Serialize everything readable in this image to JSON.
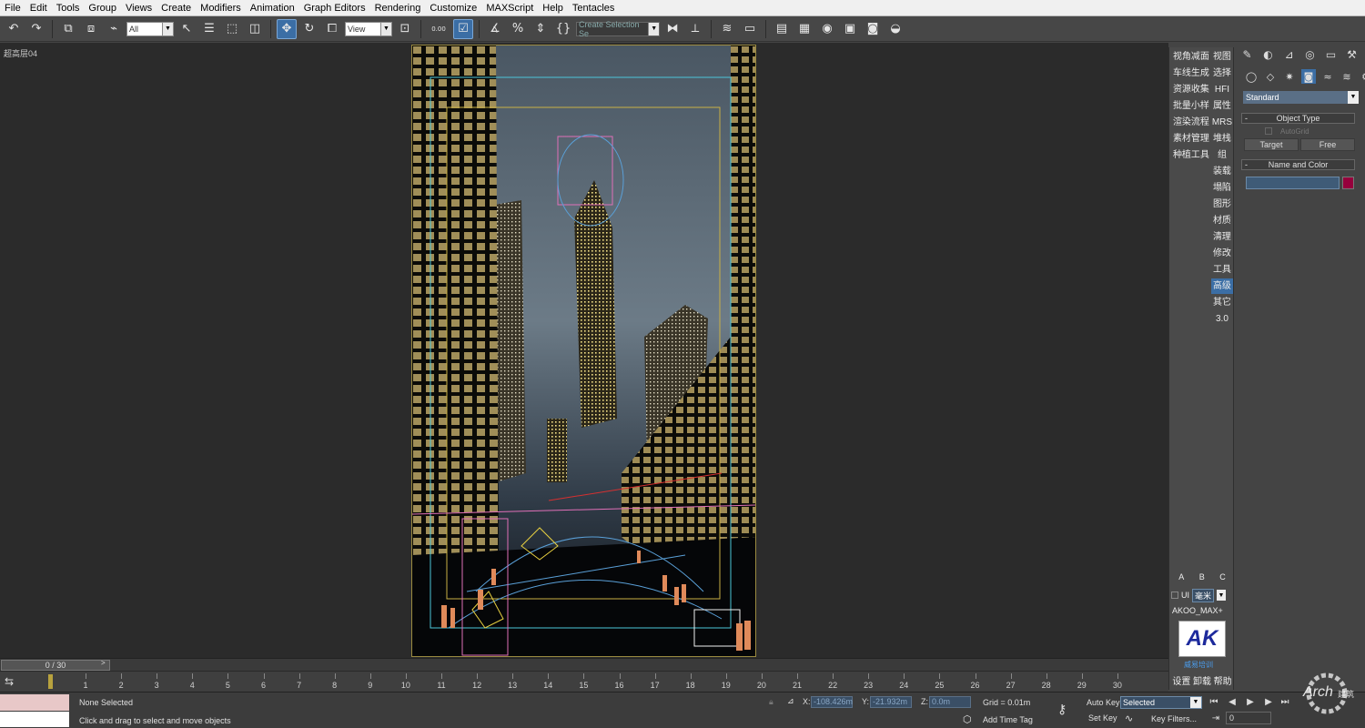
{
  "menubar": [
    "File",
    "Edit",
    "Tools",
    "Group",
    "Views",
    "Create",
    "Modifiers",
    "Animation",
    "Graph Editors",
    "Rendering",
    "Customize",
    "MAXScript",
    "Help",
    "Tentacles"
  ],
  "toolbar": {
    "filter_value": "All",
    "coord_value": "View",
    "selection_set_placeholder": "Create Selection Se",
    "snap_value": "0.00"
  },
  "viewport": {
    "label": "超高层04"
  },
  "plugin_strip": {
    "rows": [
      [
        "视角减面",
        "视图"
      ],
      [
        "车线生成",
        "选择"
      ],
      [
        "资源收集",
        "HFI"
      ],
      [
        "批量小样",
        "属性"
      ],
      [
        "渲染流程",
        "MRS"
      ],
      [
        "素材管理",
        "堆栈"
      ],
      [
        "种植工具",
        "组"
      ],
      [
        "",
        "装载"
      ],
      [
        "",
        "塌陷"
      ],
      [
        "",
        "图形"
      ],
      [
        "",
        "材质"
      ],
      [
        "",
        "清理"
      ],
      [
        "",
        "修改"
      ],
      [
        "",
        "工具"
      ],
      [
        "",
        "高级"
      ],
      [
        "",
        "其它"
      ],
      [
        "",
        "3.0"
      ]
    ],
    "highlighted": "高级",
    "abc": [
      "A",
      "B",
      "C"
    ],
    "ui_label": "UI",
    "unit_value": "毫米",
    "akoo_label": "AKOO_MAX+",
    "logo_text": "AK",
    "logo_caption": "威易培训",
    "bottom_items": [
      "设置",
      "卸载",
      "帮助"
    ]
  },
  "command_panel": {
    "dropdown_value": "Standard",
    "rollout_object_type": "Object Type",
    "autogrid_label": "AutoGrid",
    "target_button": "Target",
    "free_button": "Free",
    "rollout_name_color": "Name and Color",
    "swatch_color": "#96003c"
  },
  "timeline": {
    "slider_text": "0 / 30",
    "frames": [
      "1",
      "2",
      "3",
      "4",
      "5",
      "6",
      "7",
      "8",
      "9",
      "10",
      "11",
      "12",
      "13",
      "14",
      "15",
      "16",
      "17",
      "18",
      "19",
      "20",
      "21",
      "22",
      "23",
      "24",
      "25",
      "26",
      "27",
      "28",
      "29",
      "30"
    ]
  },
  "statusbar": {
    "selection_status": "None Selected",
    "prompt": "Click and drag to select and move objects",
    "x_label": "X:",
    "x_value": "-108.426m",
    "y_label": "Y:",
    "y_value": "-21.932m",
    "z_label": "Z:",
    "z_value": "0.0m",
    "grid": "Grid = 0.01m",
    "add_time_tag": "Add Time Tag",
    "auto_key": "Auto Key",
    "set_key": "Set Key",
    "key_mode_value": "Selected",
    "key_filters": "Key Filters...",
    "current_frame": "0"
  },
  "watermark": {
    "main": "Arch",
    "sub": "建筑"
  }
}
